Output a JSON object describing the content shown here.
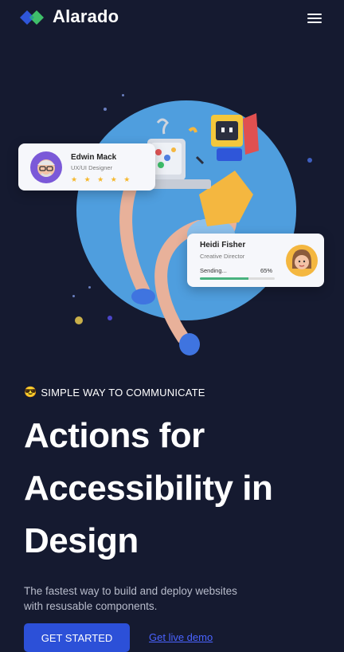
{
  "header": {
    "brand": "Alarado",
    "logo_icon": "diamond-logo-icon",
    "menu_icon": "hamburger-icon"
  },
  "hero": {
    "circle_color": "#4f9ede",
    "card_edwin": {
      "name": "Edwin Mack",
      "role": "UX/UI Designer",
      "stars": "★ ★ ★ ★ ★",
      "rating": 5
    },
    "card_heidi": {
      "name": "Heidi Fisher",
      "role": "Creative Director",
      "status": "Sending...",
      "progress_label": "65%",
      "progress": 0.65
    }
  },
  "content": {
    "tagline_emoji": "😎",
    "tagline": "SIMPLE WAY TO COMMUNICATE",
    "headline_lines": [
      "Actions for",
      "Accessibility in",
      "Design"
    ],
    "subtitle": "The fastest way to build and deploy websites with resusable components.",
    "primary_button": "GET STARTED",
    "demo_link": "Get live demo"
  },
  "colors": {
    "background": "#151a30",
    "primary": "#2c50d8",
    "link": "#4a63ff",
    "progress": "#49b27f",
    "star": "#f5b82e"
  }
}
